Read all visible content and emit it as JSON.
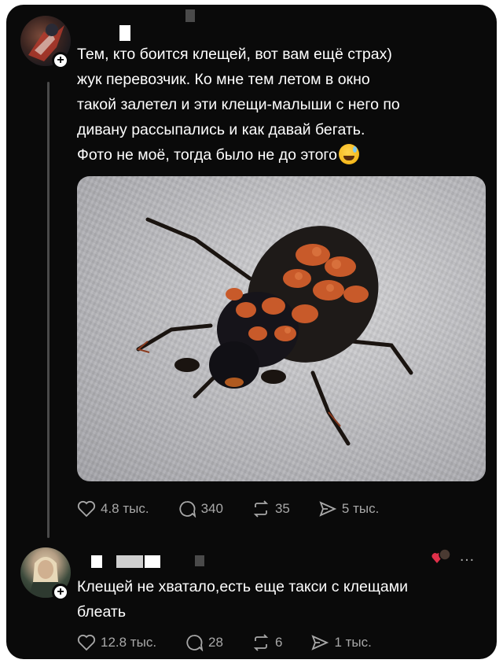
{
  "post": {
    "text": "Тем, кто боится клещей, вот вам ещё страх)\nжук перевозчик. Ко мне тем летом в окно\nтакой залетел и эти клещи-малыши с него по\nдивану рассыпались и как давай бегать.\nФото не моё, тогда было не до этого",
    "emoji": "sweat-smile-emoji",
    "image": "beetle-with-mites-photo",
    "likes": "4.8 тыс.",
    "replies": "340",
    "reposts": "35",
    "shares": "5 тыс."
  },
  "reply": {
    "text": "Клещей не хватало,есть еще такси с клещами\nблеать",
    "likes": "12.8 тыс.",
    "replies": "28",
    "reposts": "6",
    "shares": "1 тыс.",
    "more_icon": "…"
  },
  "icons": [
    "heart-icon",
    "comment-icon",
    "repost-icon",
    "share-icon",
    "plus-icon",
    "more-icon"
  ],
  "colors": {
    "background": "#0a0a0a",
    "text": "#ffffff",
    "muted": "#a8a8a8",
    "line": "#4a4a4a"
  }
}
